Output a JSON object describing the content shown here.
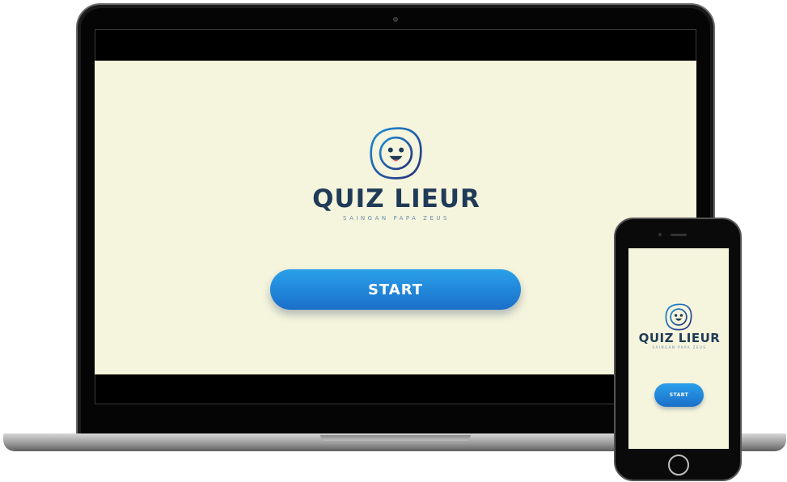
{
  "app": {
    "title": "QUIZ LIEUR",
    "subtitle": "SAINGAN PAPA ZEUS",
    "start_label": "START"
  },
  "icons": {
    "logo": "smiley-face-icon"
  },
  "colors": {
    "background": "#f5f4dc",
    "title": "#1f3b57",
    "subtitle": "#6a8fb0",
    "button_top": "#2aa0ea",
    "button_bottom": "#1a6fc9",
    "logo_gradient_start": "#1a8fd8",
    "logo_gradient_end": "#2a2f7a"
  }
}
